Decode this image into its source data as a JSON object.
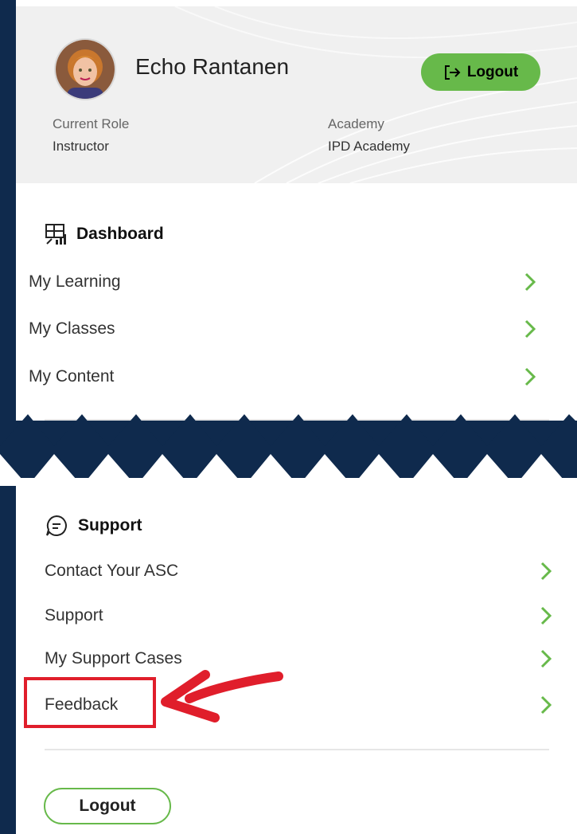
{
  "user": {
    "name": "Echo Rantanen",
    "role_label": "Current Role",
    "role_value": "Instructor",
    "academy_label": "Academy",
    "academy_value": "IPD Academy"
  },
  "header": {
    "logout_label": "Logout"
  },
  "dashboard": {
    "title": "Dashboard",
    "items": [
      {
        "label": "My Learning"
      },
      {
        "label": "My Classes"
      },
      {
        "label": "My Content"
      }
    ]
  },
  "support": {
    "title": "Support",
    "items": [
      {
        "label": "Contact Your ASC"
      },
      {
        "label": "Support"
      },
      {
        "label": "My Support Cases"
      },
      {
        "label": "Feedback"
      }
    ]
  },
  "footer": {
    "logout_label": "Logout"
  },
  "colors": {
    "accent_green": "#67b94a",
    "highlight_red": "#e01e2b",
    "background_navy": "#0f2a4d"
  },
  "icons": {
    "dashboard": "dashboard-icon",
    "support": "chat-bubble-icon",
    "chevron": "chevron-right-icon",
    "logout": "logout-icon"
  }
}
